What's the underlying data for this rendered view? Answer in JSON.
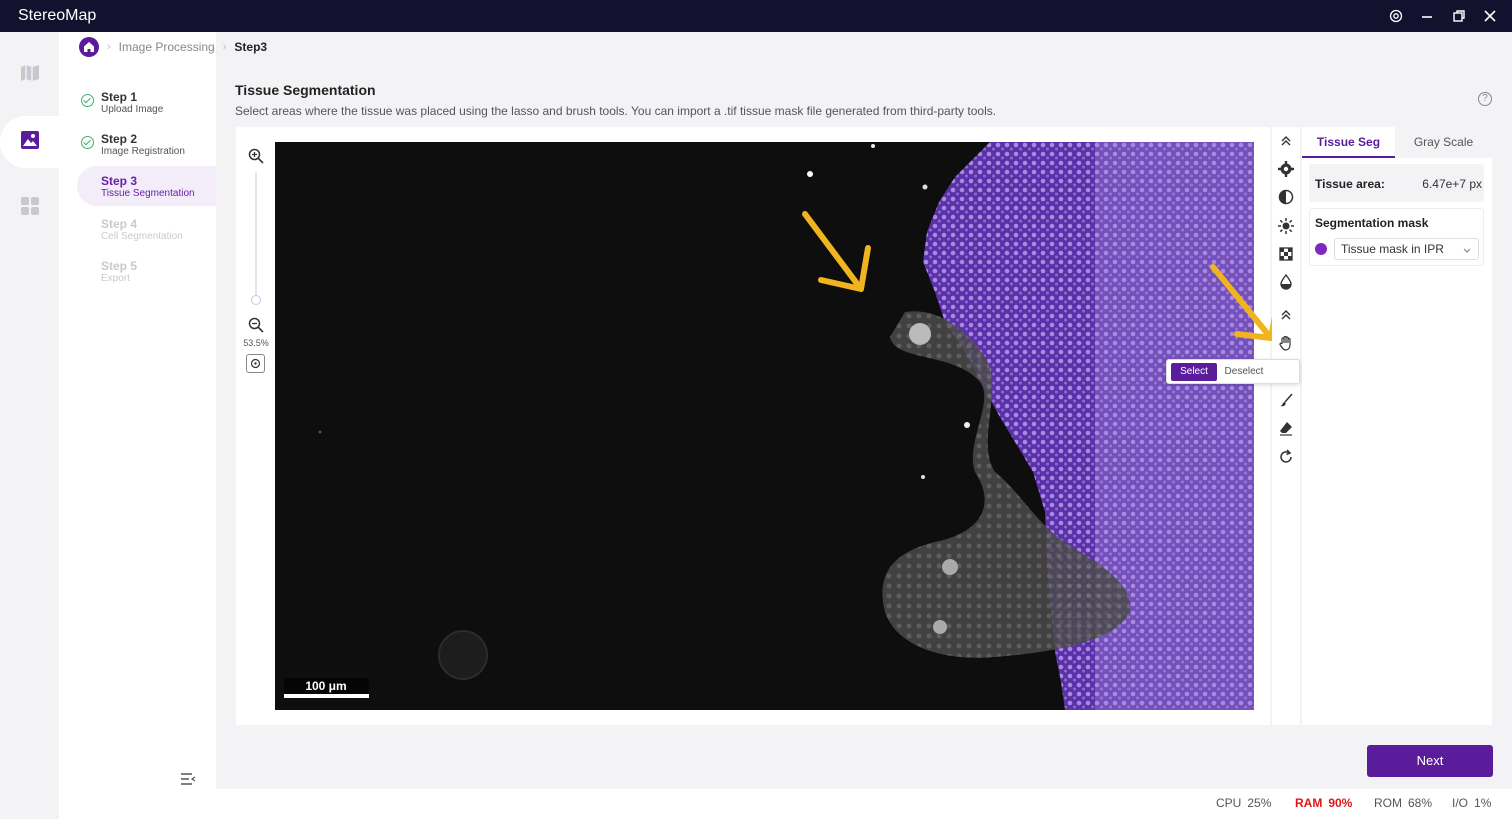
{
  "app": {
    "title": "StereoMap"
  },
  "breadcrumb": {
    "parent": "Image Processing",
    "current": "Step3"
  },
  "steps": [
    {
      "title": "Step 1",
      "subtitle": "Upload Image",
      "state": "done"
    },
    {
      "title": "Step 2",
      "subtitle": "Image Registration",
      "state": "done"
    },
    {
      "title": "Step 3",
      "subtitle": "Tissue Segmentation",
      "state": "active"
    },
    {
      "title": "Step 4",
      "subtitle": "Cell Segmentation",
      "state": "disabled"
    },
    {
      "title": "Step 5",
      "subtitle": "Export",
      "state": "disabled"
    }
  ],
  "page": {
    "title": "Tissue Segmentation",
    "description": "Select areas where the tissue was placed using the lasso and brush tools. You can import a .tif tissue mask file generated from third-party tools."
  },
  "viewer": {
    "zoom": "53.5%",
    "zoom_level": 0.535,
    "scalebar": "100 μm"
  },
  "popover": {
    "select": "Select",
    "deselect": "Deselect"
  },
  "panel": {
    "tabs": [
      "Tissue Seg",
      "Gray Scale"
    ],
    "tissue_area_label": "Tissue area:",
    "tissue_area_value": "6.47e+7 px",
    "seg_mask_label": "Segmentation mask",
    "seg_mask_value": "Tissue mask in IPR"
  },
  "actions": {
    "next": "Next"
  },
  "status": {
    "cpu_label": "CPU",
    "cpu_value": "25%",
    "ram_label": "RAM",
    "ram_value": "90%",
    "rom_label": "ROM",
    "rom_value": "68%",
    "io_label": "I/O",
    "io_value": "1%"
  },
  "colors": {
    "accent": "#5b1c9c",
    "tissue_overlay": "#7b4fc4",
    "ram_alert": "#e01616",
    "done": "#3cb16a",
    "arrow": "#f0b41e"
  }
}
